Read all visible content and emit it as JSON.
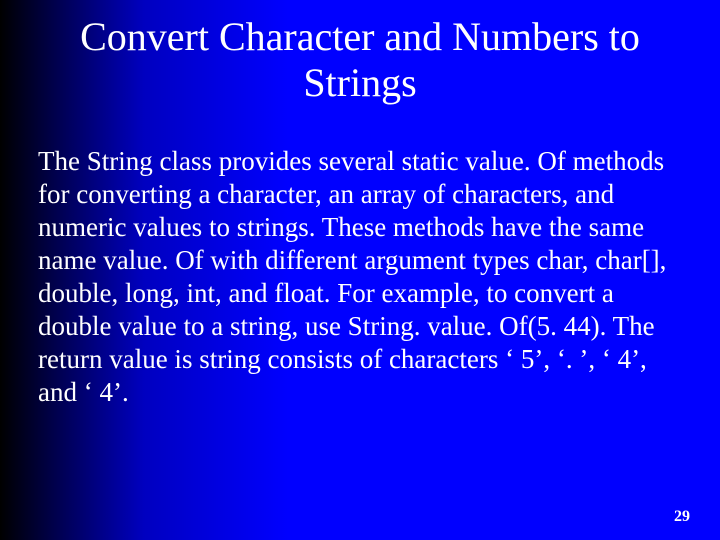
{
  "slide": {
    "title": "Convert Character and Numbers to Strings",
    "body": "The String class provides several static value. Of methods for converting a character, an array of characters, and numeric values to strings. These methods have the same name value. Of with different argument types char, char[], double, long, int, and float. For example, to convert a double value to a string, use String. value. Of(5. 44). The return value is string consists of characters ‘ 5’, ‘. ’, ‘ 4’, and ‘ 4’.",
    "page_number": "29"
  }
}
